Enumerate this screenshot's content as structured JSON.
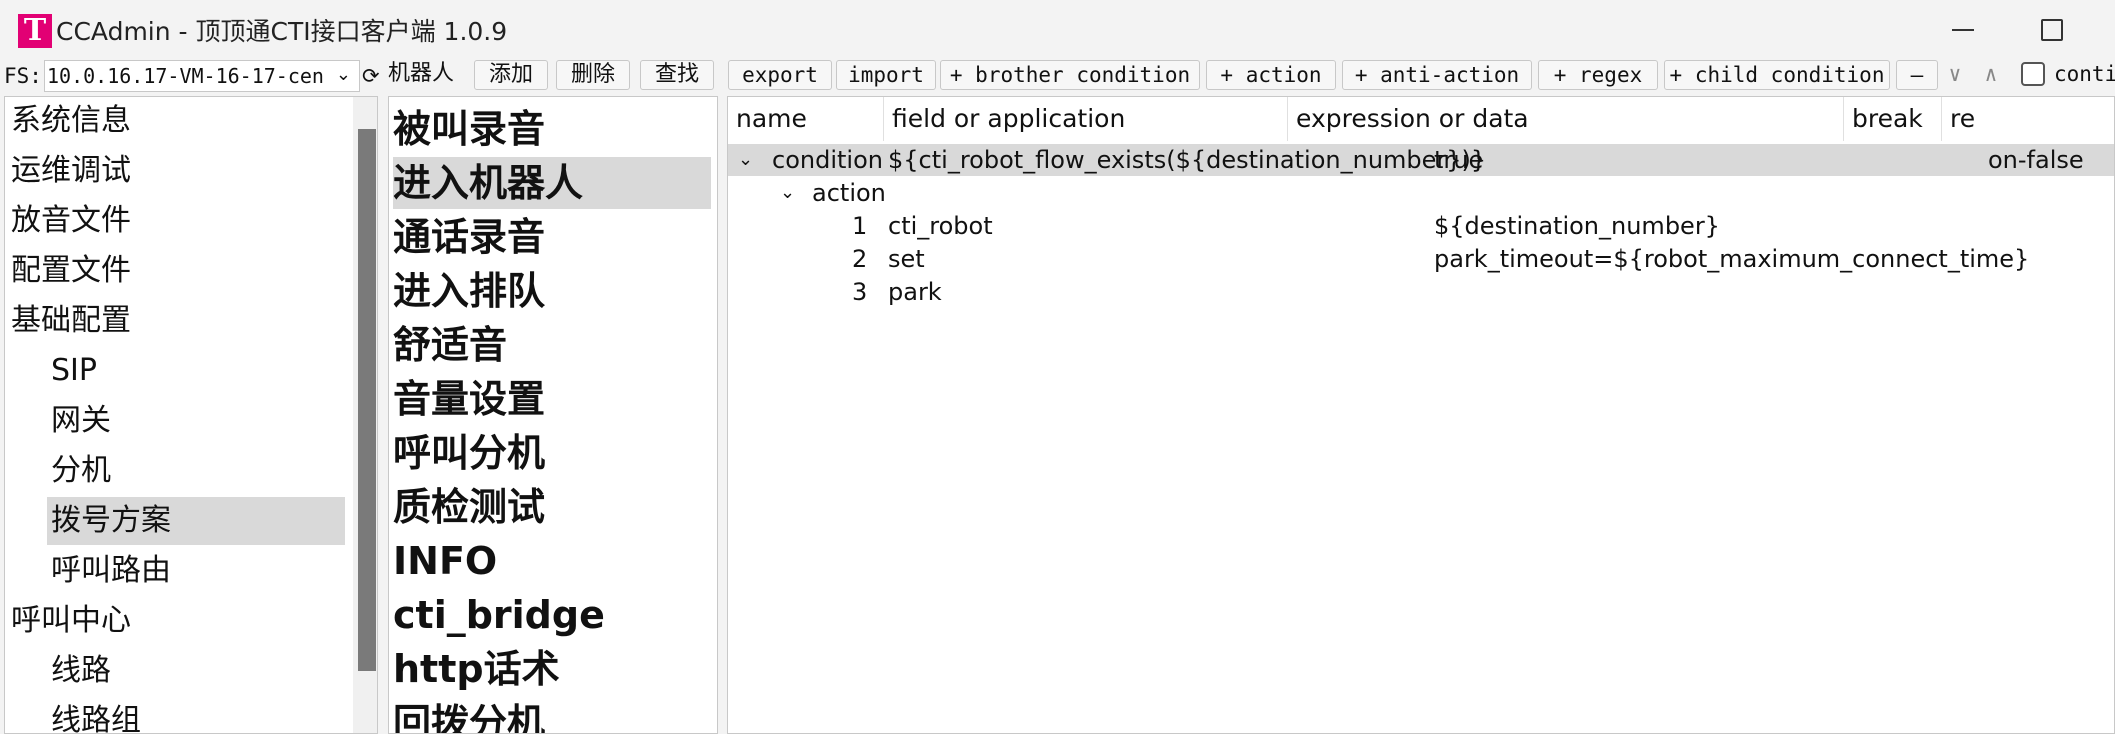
{
  "window": {
    "title": "CCAdmin - 顶顶通CTI接口客户端 1.0.9",
    "logo_letter": "T"
  },
  "toolbar": {
    "fs_label": "FS:",
    "fs_value": "10.0.16.17-VM-16-17-cen",
    "crumb": "机器人",
    "add": "添加",
    "delete": "删除",
    "find": "查找",
    "export": "export",
    "import": "import",
    "brother_condition": "+ brother condition",
    "action": "+ action",
    "anti_action": "+ anti-action",
    "regex": "+ regex",
    "child_condition": "+ child condition",
    "minus": "—",
    "down": "∨",
    "up": "∧",
    "continue_label": "conti"
  },
  "tree": [
    {
      "label": "系统信息"
    },
    {
      "label": "运维调试"
    },
    {
      "label": "放音文件"
    },
    {
      "label": "配置文件"
    },
    {
      "label": "基础配置"
    },
    {
      "label": "SIP"
    },
    {
      "label": "网关"
    },
    {
      "label": "分机"
    },
    {
      "label": "拨号方案"
    },
    {
      "label": "呼叫路由"
    },
    {
      "label": "呼叫中心"
    },
    {
      "label": "线路"
    },
    {
      "label": "线路组"
    }
  ],
  "flows": [
    {
      "label": "被叫录音"
    },
    {
      "label": "进入机器人"
    },
    {
      "label": "通话录音"
    },
    {
      "label": "进入排队"
    },
    {
      "label": "舒适音"
    },
    {
      "label": "音量设置"
    },
    {
      "label": "呼叫分机"
    },
    {
      "label": "质检测试"
    },
    {
      "label": "INFO"
    },
    {
      "label": "cti_bridge"
    },
    {
      "label": "http话术"
    },
    {
      "label": "回拨分机"
    }
  ],
  "table": {
    "headers": [
      "name",
      "field or application",
      "expression or data",
      "break",
      "re"
    ],
    "condition": {
      "name": "condition",
      "field": "${cti_robot_flow_exists(${destination_number})}",
      "expression": "true",
      "break": "on-false"
    },
    "action_group": "action",
    "actions": [
      {
        "index": "1",
        "app": "cti_robot",
        "data": "${destination_number}"
      },
      {
        "index": "2",
        "app": "set",
        "data": "park_timeout=${robot_maximum_connect_time}"
      },
      {
        "index": "3",
        "app": "park",
        "data": ""
      }
    ]
  },
  "icons": {
    "refresh": "refresh-icon",
    "chevron_down": "chevron-down-icon",
    "minimize": "minimize-icon",
    "maximize": "maximize-icon"
  },
  "colors": {
    "brand": "#e20074",
    "selection": "#d9d9d9"
  }
}
